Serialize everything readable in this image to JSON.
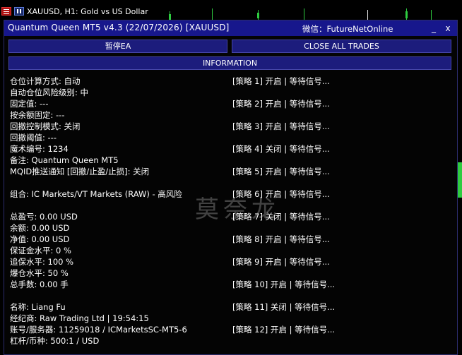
{
  "chart": {
    "title": "XAUUSD, H1:  Gold vs US Dollar"
  },
  "panel": {
    "title": "Quantum Queen MT5 v4.3 (22/07/2026) [XAUUSD]",
    "wechat": "微信：FutureNetOnline",
    "minimize": "_",
    "close": "x",
    "pause_button": "暂停EA",
    "close_all_button": "CLOSE ALL TRADES",
    "info_button": "INFORMATION",
    "watermark": "莫奈龙"
  },
  "info_left": [
    "仓位计算方式: 自动",
    "自动仓位风险级别: 中",
    "固定值: ---",
    "按余额固定: ---",
    "回撤控制模式: 关闭",
    "回撤阈值: ---",
    "魔术编号: 1234",
    "备注: Quantum Queen MT5",
    "MQID推送通知 [回撤/止盈/止损]: 关闭",
    "组合: IC Markets/VT Markets (RAW) - 高风险",
    "总盈亏: 0.00 USD",
    "余额: 0.00 USD",
    "净值: 0.00 USD",
    "保证金水平: 0 %",
    "追保水平: 100 %",
    "爆仓水平: 50 %",
    "总手数: 0.00 手",
    "名称: Liang Fu",
    "经纪商: Raw Trading Ltd | 19:54:15",
    "账号/服务器: 11259018 / ICMarketsSC-MT5-6",
    "杠杆/币种: 500:1 / USD"
  ],
  "strategies": [
    "[策略 1] 开启 | 等待信号...",
    "[策略 2] 开启 | 等待信号...",
    "[策略 3] 开启 | 等待信号...",
    "[策略 4] 关闭 | 等待信号...",
    "[策略 5] 开启 | 等待信号...",
    "[策略 6] 开启 | 等待信号...",
    "[策略 7] 关闭 | 等待信号...",
    "[策略 8] 开启 | 等待信号...",
    "[策略 9] 开启 | 等待信号...",
    "[策略 10] 开启 | 等待信号...",
    "[策略 11] 关闭 | 等待信号...",
    "[策略 12] 开启 | 等待信号..."
  ],
  "colors": {
    "titlebar": "#17178c",
    "button": "#1c1c7c",
    "candle_up": "#2ecc40"
  }
}
